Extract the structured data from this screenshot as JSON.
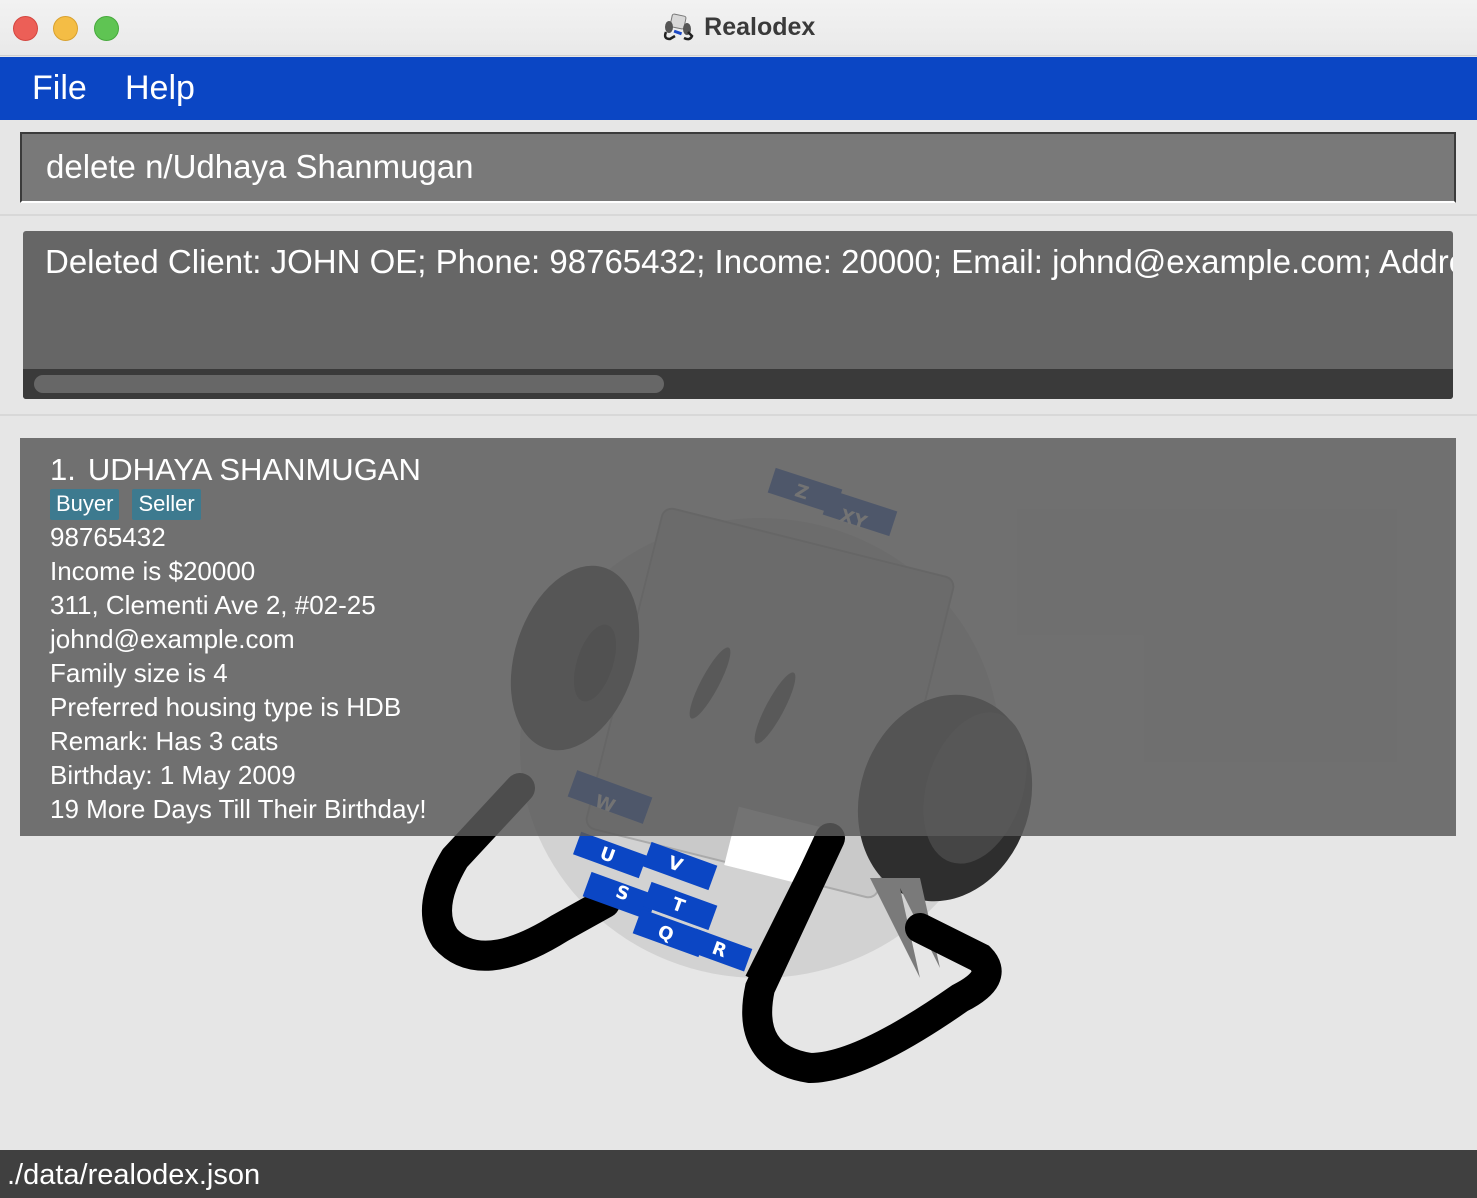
{
  "window": {
    "title": "Realodex",
    "icon": "rolodex-app-icon"
  },
  "menu": {
    "file": "File",
    "help": "Help"
  },
  "command": {
    "value": "delete n/Udhaya Shanmugan"
  },
  "result": {
    "text": "Deleted Client: JOHN OE; Phone: 98765432; Income: 20000; Email: johnd@example.com; Addre"
  },
  "persons": [
    {
      "index": "1.",
      "name": "UDHAYA SHANMUGAN",
      "tags": [
        "Buyer",
        "Seller"
      ],
      "phone": "98765432",
      "income": "Income is $20000",
      "address": "311, Clementi Ave 2, #02-25",
      "email": "johnd@example.com",
      "family": "Family size is 4",
      "housing": "Preferred housing type is HDB",
      "remark": "Remark: Has 3 cats",
      "birthday": "Birthday: 1 May 2009",
      "countdown": "19 More Days Till Their Birthday!"
    }
  ],
  "background": {
    "logo": "rolodex-logo",
    "tab_letters": [
      "Z",
      "XY",
      "W",
      "U",
      "V",
      "S",
      "T",
      "Q",
      "R"
    ],
    "accent": "#0b46c4"
  },
  "status": {
    "path": "./data/realodex.json"
  },
  "colors": {
    "menubar": "#0b46c4",
    "tag": "#3d7a8f",
    "panel": "#666666",
    "statusbar": "#404040"
  }
}
